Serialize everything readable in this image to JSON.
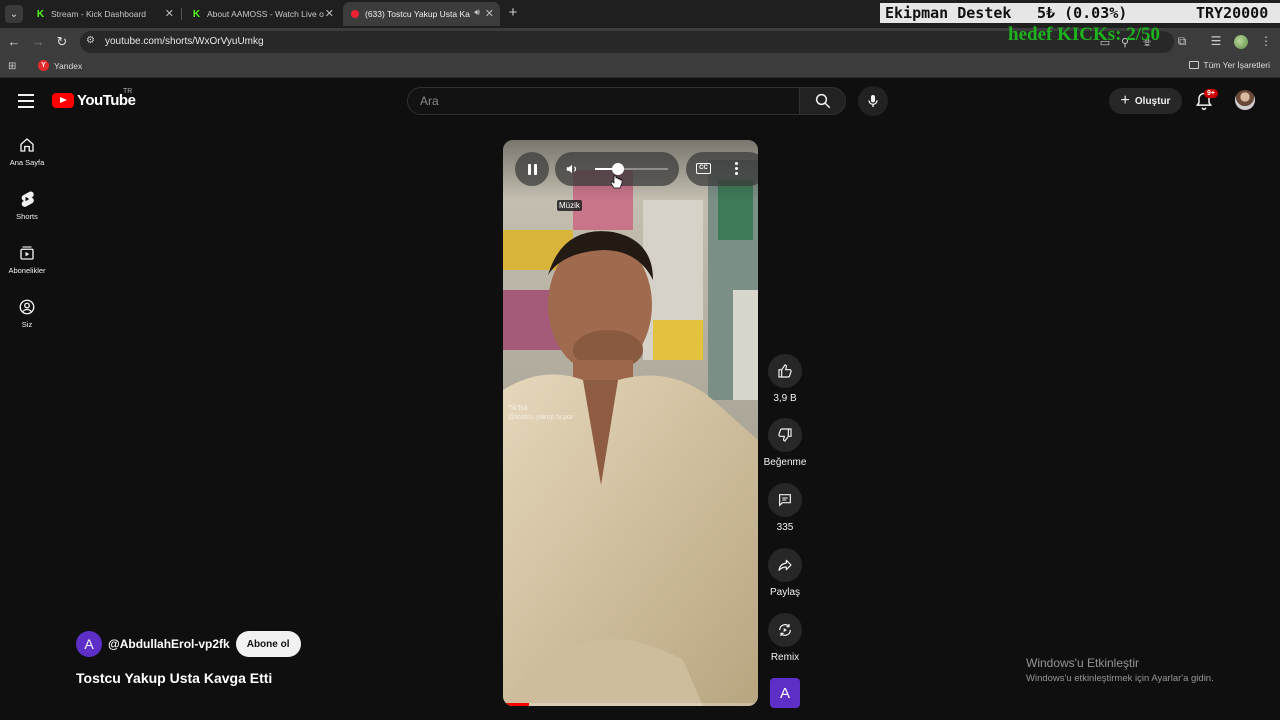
{
  "browser": {
    "tabs": [
      {
        "title": "Stream - Kick Dashboard",
        "favicon": "kick-icon",
        "active": false
      },
      {
        "title": "About AAMOSS - Watch Live o",
        "favicon": "kick-icon",
        "active": false
      },
      {
        "title": "(633) Tostcu Yakup Usta Ka",
        "favicon": "youtube-icon",
        "active": true
      }
    ],
    "url": "youtube.com/shorts/WxOrVyuUmkg",
    "bookmarks": [
      {
        "label": "Yandex",
        "icon": "Y"
      }
    ],
    "all_bookmarks_label": "Tüm Yer İşaretleri"
  },
  "stream_overlay": {
    "ticker_left": "Ekipman Destek",
    "ticker_mid": "5₺ (0.03%)",
    "ticker_right": "TRY20000",
    "goal_text": "hedef KICKs: 2/50"
  },
  "youtube": {
    "logo_word": "YouTube",
    "region": "TR",
    "search_placeholder": "Ara",
    "create_label": "Oluştur",
    "notification_count": "9+",
    "sidebar": [
      {
        "label": "Ana Sayfa",
        "icon": "home-icon"
      },
      {
        "label": "Shorts",
        "icon": "shorts-icon"
      },
      {
        "label": "Abonelikler",
        "icon": "subscriptions-icon"
      },
      {
        "label": "Siz",
        "icon": "you-icon"
      }
    ],
    "player": {
      "tooltip": "Müzik",
      "volume": 0.32,
      "progress": 0.1,
      "watermark_app": "TikTok",
      "watermark_handle": "@tostcu.yakup.tv.por"
    },
    "actions": {
      "like_count": "3,9 B",
      "dislike_label": "Beğenme",
      "comment_count": "335",
      "share_label": "Paylaş",
      "remix_label": "Remix",
      "channel_initial": "A"
    },
    "channel": {
      "initial": "A",
      "handle": "@AbdullahErol-vp2fk",
      "subscribe_label": "Abone ol",
      "avatar_color": "#5d2fc7"
    },
    "video_title": "Tostcu Yakup Usta Kavga Etti"
  },
  "windows_watermark": {
    "title": "Windows'u Etkinleştir",
    "subtitle": "Windows'u etkinleştirmek için Ayarlar'a gidin."
  },
  "colors": {
    "background": "#0f0f0f",
    "youtube_red": "#ff0000",
    "kick_green": "#53fc18",
    "goal_green": "#1db31d"
  }
}
